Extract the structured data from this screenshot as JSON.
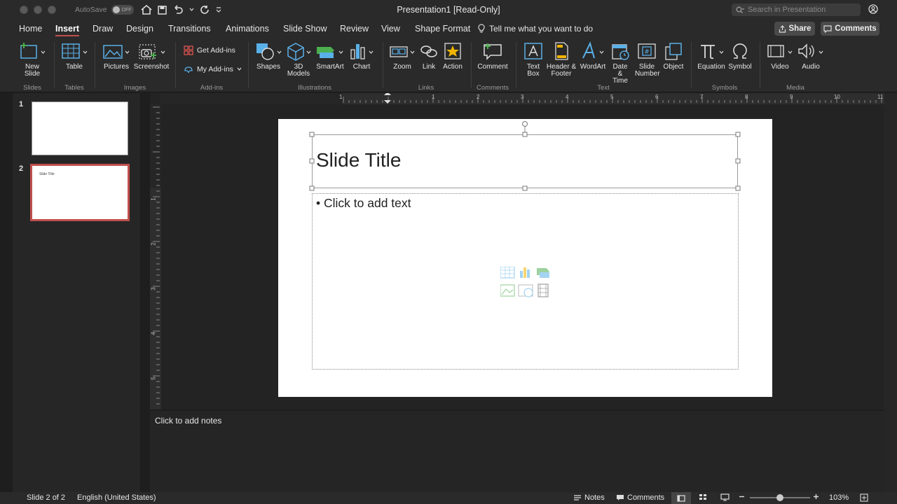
{
  "window": {
    "title": "Presentation1 [Read-Only]",
    "autosave_label": "AutoSave",
    "autosave_state": "OFF"
  },
  "search": {
    "placeholder": "Search in Presentation"
  },
  "tabs": [
    "Home",
    "Insert",
    "Draw",
    "Design",
    "Transitions",
    "Animations",
    "Slide Show",
    "Review",
    "View",
    "Shape Format"
  ],
  "tell_me": "Tell me what you want to do",
  "share_label": "Share",
  "comments_label": "Comments",
  "ribbon": {
    "new_slide": "New Slide",
    "table": "Table",
    "pictures": "Pictures",
    "screenshot": "Screenshot",
    "get_addins": "Get Add-ins",
    "my_addins": "My Add-ins",
    "shapes": "Shapes",
    "models": "3D Models",
    "smartart": "SmartArt",
    "chart": "Chart",
    "zoom": "Zoom",
    "link": "Link",
    "action": "Action",
    "comment": "Comment",
    "textbox": "Text Box",
    "header_footer": "Header & Footer",
    "wordart": "WordArt",
    "datetime": "Date & Time",
    "slidenumber": "Slide Number",
    "object": "Object",
    "equation": "Equation",
    "symbol": "Symbol",
    "video": "Video",
    "audio": "Audio",
    "groups": {
      "slides": "Slides",
      "tables": "Tables",
      "images": "Images",
      "addins": "Add-ins",
      "illustrations": "Illustrations",
      "links": "Links",
      "comments": "Comments",
      "text": "Text",
      "symbols": "Symbols",
      "media": "Media"
    }
  },
  "thumbnails": [
    {
      "num": "1",
      "title": ""
    },
    {
      "num": "2",
      "title": "Slide Title"
    }
  ],
  "slide": {
    "title": "Slide Title",
    "bullet": "Click to add text"
  },
  "ruler_h": [
    "1",
    "1",
    "2",
    "3",
    "4",
    "5",
    "6",
    "7",
    "8",
    "9",
    "10",
    "11"
  ],
  "ruler_v": [
    "1",
    "2",
    "3",
    "4",
    "5"
  ],
  "notes_placeholder": "Click to add notes",
  "status": {
    "slide": "Slide 2 of 2",
    "language": "English (United States)",
    "notes": "Notes",
    "comments": "Comments",
    "zoom": "103%"
  }
}
